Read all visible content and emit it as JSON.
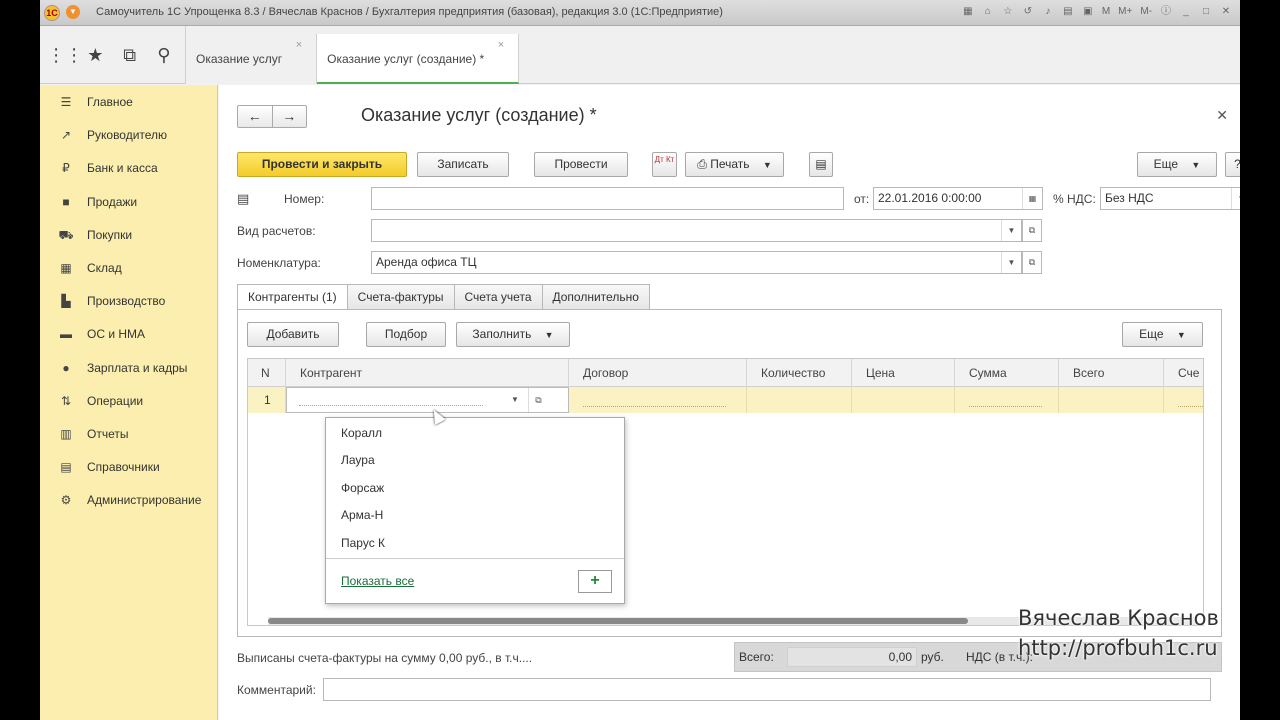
{
  "window": {
    "title": "Самоучитель 1С Упрощенка 8.3 / Вячеслав Краснов / Бухгалтерия предприятия (базовая), редакция 3.0  (1С:Предприятие)",
    "title_icons": [
      "grid-icon",
      "home-icon",
      "star-icon",
      "history-icon",
      "bell-icon",
      "calendar-icon",
      "calculator-icon"
    ],
    "m_label": "M",
    "mplus_label": "M+",
    "mminus_label": "M-"
  },
  "quick_icons": [
    "apps-icon",
    "star-icon",
    "history-icon",
    "search-icon"
  ],
  "open_tabs": [
    {
      "label": "Оказание услуг"
    },
    {
      "label": "Оказание услуг (создание) *"
    }
  ],
  "sidebar": {
    "items": [
      {
        "label": "Главное",
        "icon": "menu-icon"
      },
      {
        "label": "Руководителю",
        "icon": "trend-icon"
      },
      {
        "label": "Банк и касса",
        "icon": "ruble-icon"
      },
      {
        "label": "Продажи",
        "icon": "bag-icon"
      },
      {
        "label": "Покупки",
        "icon": "cart-icon"
      },
      {
        "label": "Склад",
        "icon": "warehouse-icon"
      },
      {
        "label": "Производство",
        "icon": "factory-icon"
      },
      {
        "label": "ОС и НМА",
        "icon": "truck-icon"
      },
      {
        "label": "Зарплата и кадры",
        "icon": "person-icon"
      },
      {
        "label": "Операции",
        "icon": "dt-kt-icon"
      },
      {
        "label": "Отчеты",
        "icon": "bar-chart-icon"
      },
      {
        "label": "Справочники",
        "icon": "books-icon"
      },
      {
        "label": "Администрирование",
        "icon": "gear-icon"
      }
    ]
  },
  "document": {
    "title": "Оказание услуг (создание) *",
    "toolbar": {
      "post_close": "Провести и закрыть",
      "save": "Записать",
      "post": "Провести",
      "dtkt": "Дт Кт",
      "print": "Печать",
      "more": "Еще",
      "help": "?"
    },
    "fields": {
      "number_label": "Номер:",
      "number_value": "",
      "date_label": "от:",
      "date_value": "22.01.2016  0:00:00",
      "vat_label": "% НДС:",
      "vat_value": "Без НДС",
      "payment_type_label": "Вид расчетов:",
      "payment_type_value": "",
      "nomenclature_label": "Номенклатура:",
      "nomenclature_value": "Аренда офиса ТЦ"
    },
    "tabs": [
      {
        "label": "Контрагенты (1)"
      },
      {
        "label": "Счета-фактуры"
      },
      {
        "label": "Счета учета"
      },
      {
        "label": "Дополнительно"
      }
    ],
    "table_toolbar": {
      "add": "Добавить",
      "pick": "Подбор",
      "fill": "Заполнить",
      "more": "Еще"
    },
    "table": {
      "columns": [
        "N",
        "Контрагент",
        "Договор",
        "Количество",
        "Цена",
        "Сумма",
        "Всего",
        "Сче"
      ],
      "rows": [
        {
          "n": "1",
          "counterparty": "",
          "contract": ""
        }
      ]
    },
    "dropdown": {
      "items": [
        "Коралл",
        "Лаура",
        "Форсаж",
        "Арма-Н",
        "Парус К"
      ],
      "show_all": "Показать все",
      "add_symbol": "+"
    },
    "summary_text": "Выписаны счета-фактуры на сумму 0,00 руб., в т.ч....",
    "totals": {
      "total_label": "Всего:",
      "total_value": "0,00",
      "currency": "руб.",
      "vat_label": "НДС (в т.ч.):"
    },
    "comment_label": "Комментарий:",
    "comment_value": ""
  },
  "watermark": {
    "author": "Вячеслав Краснов",
    "url": "http://profbuh1c.ru"
  },
  "colors": {
    "sidebar_bg": "#fbeeae",
    "primary_button": "#f4cc2a",
    "active_tab_accent": "#4caf50",
    "selected_row": "#fbf2c4",
    "link": "#1b6c3a"
  }
}
